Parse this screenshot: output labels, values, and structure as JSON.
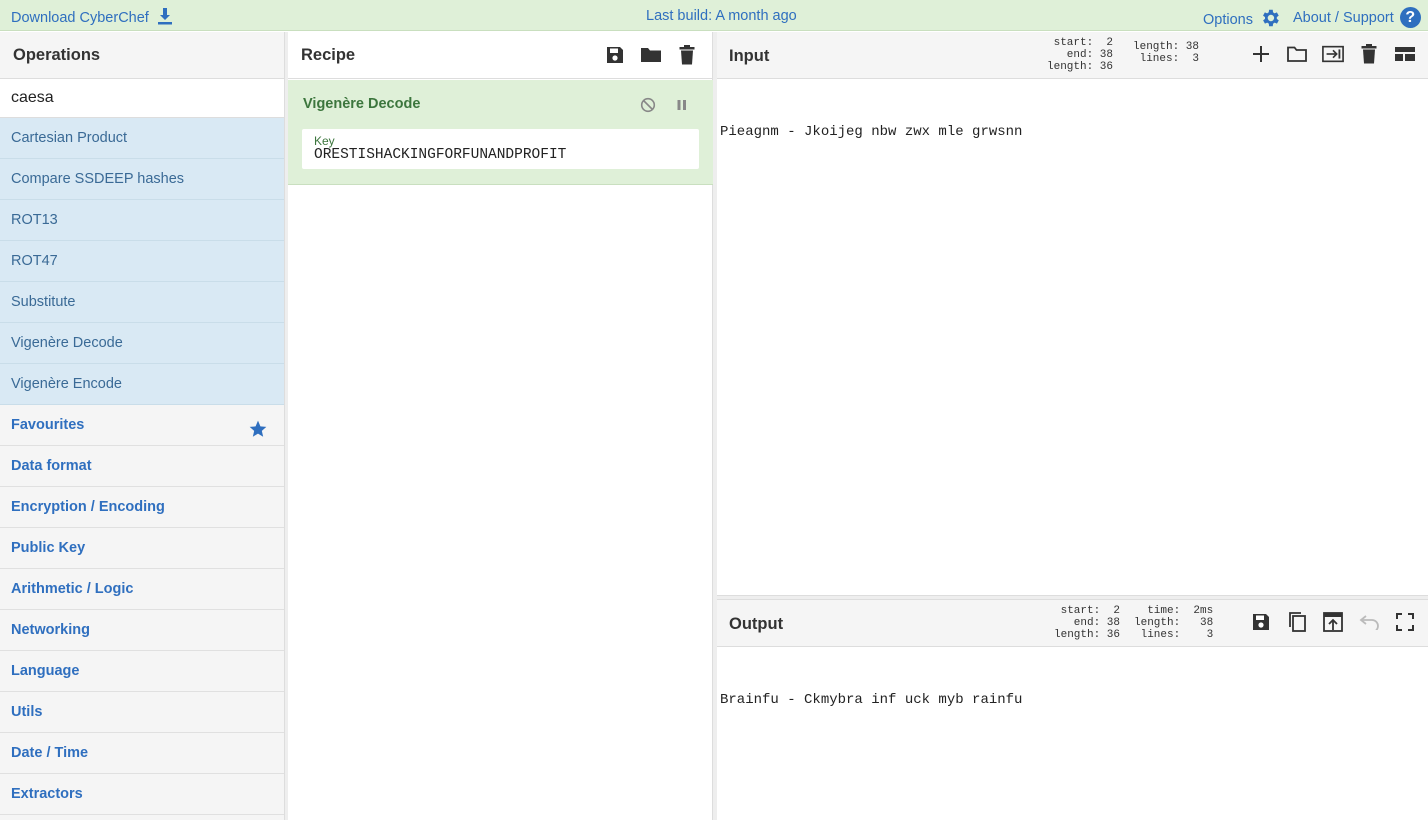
{
  "banner": {
    "download": "Download CyberChef",
    "last_build": "Last build: A month ago",
    "options": "Options",
    "about": "About / Support",
    "help_glyph": "?"
  },
  "operations": {
    "title": "Operations",
    "search_value": "caesa",
    "results": [
      "Cartesian Product",
      "Compare SSDEEP hashes",
      "ROT13",
      "ROT47",
      "Substitute",
      "Vigenère Decode",
      "Vigenère Encode"
    ],
    "categories": [
      "Favourites",
      "Data format",
      "Encryption / Encoding",
      "Public Key",
      "Arithmetic / Logic",
      "Networking",
      "Language",
      "Utils",
      "Date / Time",
      "Extractors"
    ]
  },
  "recipe": {
    "title": "Recipe",
    "operation_name": "Vigenère Decode",
    "key_label": "Key",
    "key_value": "ORESTISHACKINGFORFUNANDPROFIT"
  },
  "input": {
    "title": "Input",
    "stats_sel": "start:  2\n  end: 38\nlength: 36",
    "stats_len": "length: 38\n lines:  3",
    "text": "Pieagnm - Jkoijeg nbw zwx mle grwsnn"
  },
  "output": {
    "title": "Output",
    "stats_sel": "start:  2\n  end: 38\nlength: 36",
    "stats_time": "  time:  2ms\nlength:   38\n lines:    3",
    "text": "Brainfu - Ckmybra inf uck myb rainfu"
  },
  "colors": {
    "accent": "#2f6fbf",
    "banner_bg": "#dff0d8",
    "op_highlight": "#d9e9f4",
    "recipe_green": "#3c763d"
  }
}
